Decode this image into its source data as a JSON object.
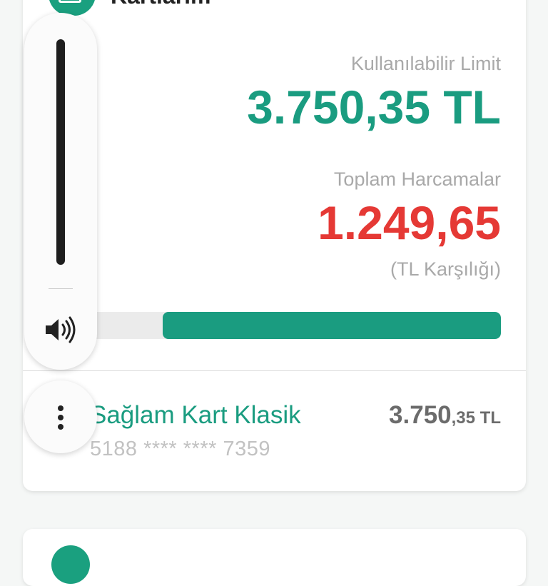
{
  "header": {
    "title": "Kartlarım"
  },
  "limit": {
    "label": "Kullanılabilir Limit",
    "value": "3.750,35 TL"
  },
  "spending": {
    "label": "Toplam Harcamalar",
    "value": "1.249,65",
    "currency_note": "(TL Karşılığı)"
  },
  "usage_bar": {
    "available_fraction": 0.8
  },
  "account": {
    "name": "Sağlam Kart Klasik",
    "number": "5188 **** **** 7359",
    "amount_int": "3.750",
    "amount_dec": ",35 TL"
  },
  "overlay": {
    "volume_icon": "speaker-volume-icon",
    "more_icon": "more-vertical-icon"
  },
  "colors": {
    "accent": "#1a9c80",
    "negative": "#e53935"
  }
}
